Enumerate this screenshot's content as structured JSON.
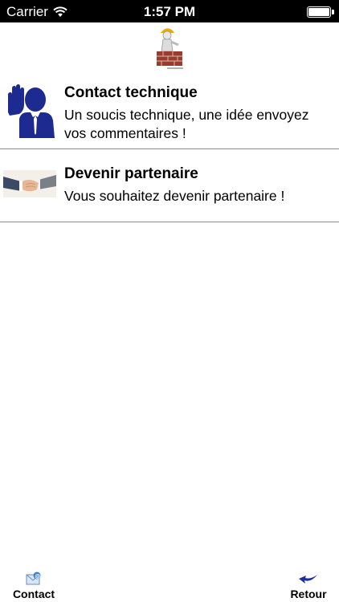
{
  "status_bar": {
    "carrier": "Carrier",
    "time": "1:57 PM"
  },
  "logo": {
    "icon": "worker-brick-wall-logo"
  },
  "list": [
    {
      "title": "Contact technique",
      "description": "Un soucis technique, une idée envoyez vos commentaires !",
      "icon": "businessman-raised-hand-icon"
    },
    {
      "title": "Devenir partenaire",
      "description": "Vous souhaitez devenir partenaire !",
      "icon": "handshake-icon"
    }
  ],
  "tab_bar": {
    "contact_label": "Contact",
    "retour_label": "Retour",
    "colors": {
      "accent": "#1f2f9c"
    }
  }
}
